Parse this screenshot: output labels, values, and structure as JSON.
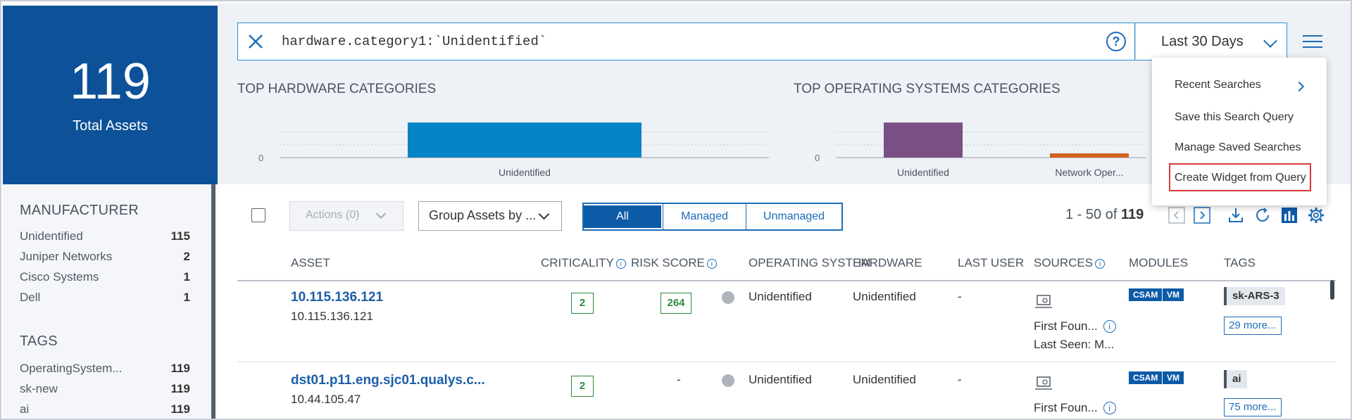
{
  "summary": {
    "total_count": "119",
    "total_label": "Total Assets"
  },
  "facets": [
    {
      "title": "MANUFACTURER",
      "items": [
        {
          "label": "Unidentified",
          "count": "115"
        },
        {
          "label": "Juniper Networks",
          "count": "2"
        },
        {
          "label": "Cisco Systems",
          "count": "1"
        },
        {
          "label": "Dell",
          "count": "1"
        }
      ]
    },
    {
      "title": "TAGS",
      "items": [
        {
          "label": "OperatingSystem...",
          "count": "119"
        },
        {
          "label": "sk-new",
          "count": "119"
        },
        {
          "label": "ai",
          "count": "119"
        }
      ]
    }
  ],
  "search": {
    "query": "hardware.category1:`Unidentified`",
    "help": "?"
  },
  "date_range": {
    "label": "Last 30 Days"
  },
  "menu": {
    "items": [
      {
        "label": "Recent Searches",
        "submenu": true
      },
      {
        "label": "Save this Search Query"
      },
      {
        "label": "Manage Saved Searches"
      },
      {
        "label": "Create Widget from Query",
        "highlighted": true
      }
    ]
  },
  "chart_data": [
    {
      "type": "bar",
      "title": "TOP HARDWARE CATEGORIES",
      "categories": [
        "Unidentified"
      ],
      "values": [
        115
      ],
      "ylim": [
        0,
        120
      ],
      "tick_zero": "0",
      "color": "#0685c6"
    },
    {
      "type": "bar",
      "title": "TOP OPERATING SYSTEMS CATEGORIES",
      "categories": [
        "Unidentified",
        "Network Oper..."
      ],
      "values": [
        115,
        3
      ],
      "ylim": [
        0,
        120
      ],
      "tick_zero": "0",
      "colors": [
        "#7a4f85",
        "#d2621f"
      ]
    }
  ],
  "toolbar": {
    "actions_label": "Actions (0)",
    "group_label": "Group Assets by ...",
    "filters": [
      "All",
      "Managed",
      "Unmanaged"
    ],
    "active_filter": "All",
    "range_text": "1 - 50 of",
    "total": "119"
  },
  "table": {
    "columns": [
      "ASSET",
      "CRITICALITY",
      "RISK SCORE",
      "OPERATING SYSTEM",
      "HARDWARE",
      "LAST USER",
      "SOURCES",
      "MODULES",
      "TAGS"
    ],
    "rows": [
      {
        "name": "10.115.136.121",
        "ip": "10.115.136.121",
        "criticality": "2",
        "risk": "264",
        "os": "Unidentified",
        "hardware": "Unidentified",
        "last_user": "-",
        "first_found": "First Foun...",
        "last_seen": "Last Seen: M...",
        "modules": [
          "CSAM",
          "VM"
        ],
        "tag": "sk-ARS-3",
        "more": "29 more..."
      },
      {
        "name": "dst01.p11.eng.sjc01.qualys.c...",
        "ip": "10.44.105.47",
        "criticality": "2",
        "risk": "-",
        "os": "Unidentified",
        "hardware": "Unidentified",
        "last_user": "-",
        "first_found": "First Foun...",
        "last_seen": "",
        "modules": [
          "CSAM",
          "VM"
        ],
        "tag": "ai",
        "more": "75 more..."
      }
    ]
  }
}
